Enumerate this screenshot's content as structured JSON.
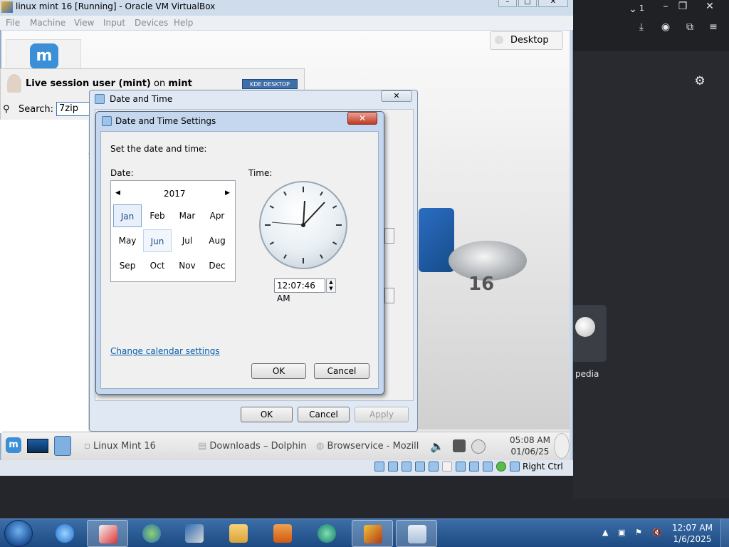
{
  "host_window": {
    "title": "linux mint 16 [Running] - Oracle VM VirtualBox",
    "menu": [
      "File",
      "Machine",
      "View",
      "Input",
      "Devices",
      "Help"
    ],
    "status_host_key": "Right Ctrl"
  },
  "browser": {
    "tab_count": "1",
    "desktop_tab": "Desktop",
    "tile_label": "pedia"
  },
  "guest": {
    "session_user": "Live session user (mint)",
    "session_on": "on",
    "session_host": "mint",
    "kde_badge": "KDE DESKTOP",
    "search_label": "Search:",
    "search_value": "7zip",
    "taskbar": {
      "task1": "Linux Mint 16",
      "task2": "Downloads – Dolphin",
      "task3": "Browservice - Mozill"
    },
    "clock_time": "05:08 AM",
    "clock_date": "01/06/25",
    "logo_number": "16"
  },
  "outer_dialog": {
    "title": "Date and Time",
    "ok": "OK",
    "cancel": "Cancel",
    "apply": "Apply"
  },
  "inner_dialog": {
    "title": "Date and Time Settings",
    "instruction": "Set the date and time:",
    "date_label": "Date:",
    "time_label": "Time:",
    "year": "2017",
    "months": [
      "Jan",
      "Feb",
      "Mar",
      "Apr",
      "May",
      "Jun",
      "Jul",
      "Aug",
      "Sep",
      "Oct",
      "Nov",
      "Dec"
    ],
    "selected_month": "Jan",
    "current_month": "Jun",
    "time_value": "12:07:46 AM",
    "calendar_link": "Change calendar settings",
    "ok": "OK",
    "cancel": "Cancel"
  },
  "host_taskbar": {
    "time": "12:07 AM",
    "date": "1/6/2025"
  }
}
